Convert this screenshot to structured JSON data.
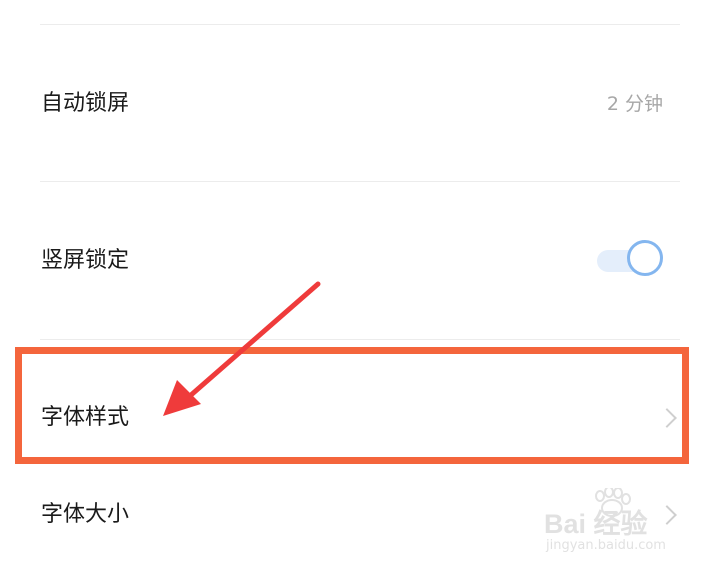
{
  "settings": {
    "auto_lock": {
      "label": "自动锁屏",
      "value": "2 分钟"
    },
    "portrait_lock": {
      "label": "竖屏锁定",
      "enabled": true
    },
    "font_style": {
      "label": "字体样式"
    },
    "font_size": {
      "label": "字体大小"
    }
  },
  "colors": {
    "toggle_track": "#e4eefb",
    "toggle_knob_border": "#84b6ef",
    "annotation_box": "#f4653c",
    "annotation_arrow": "#ef3b3b",
    "watermark": "#c9c9c9"
  },
  "icons": {
    "row_arrow": "chevron-right-icon",
    "annotation": "red-arrow-icon",
    "watermark": "baidu-paw-logo"
  },
  "watermark": {
    "text": "Bai 经验",
    "url": "jingyan.baidu.com"
  }
}
